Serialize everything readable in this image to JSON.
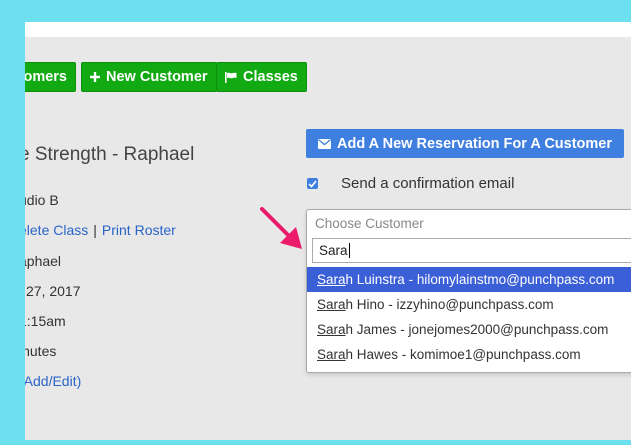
{
  "nav": {
    "customers_label": "omers",
    "new_customer_label": "New Customer",
    "classes_label": "Classes"
  },
  "class_info": {
    "title": "e Strength - Raphael",
    "room": "udio B",
    "delete_link": "elete Class",
    "separator": "|",
    "print_roster_link": "Print Roster",
    "instructor": "aphael",
    "date": "l 27, 2017",
    "time": "1:15am",
    "duration": "inutes",
    "add_edit_link": "(Add/Edit)"
  },
  "reservation": {
    "add_button_label": "Add A New Reservation For A Customer",
    "confirmation_label": "Send a confirmation email",
    "confirmation_checked": true
  },
  "customer_select": {
    "placeholder": "Choose Customer",
    "search_value": "Sara",
    "options": [
      {
        "match": "Sara",
        "rest": "h Luinstra - hilomylainstmo@punchpass.com",
        "active": true
      },
      {
        "match": "Sara",
        "rest": "h Hino - izzyhino@punchpass.com",
        "active": false
      },
      {
        "match": "Sara",
        "rest": "h James - jonejomes2000@punchpass.com",
        "active": false
      },
      {
        "match": "Sara",
        "rest": "h Hawes - komimoe1@punchpass.com",
        "active": false
      }
    ]
  },
  "colors": {
    "frame_background": "#6de0ef",
    "nav_button_green": "#12aa12",
    "primary_blue": "#3f7fe0",
    "highlight_option": "#3b5fd6",
    "annotation_arrow": "#ec1a6b"
  },
  "icons": {
    "new_customer": "plus-icon",
    "classes": "flag-icon",
    "add_reservation": "envelope-icon",
    "pointer": "arrow-annotation-icon"
  }
}
